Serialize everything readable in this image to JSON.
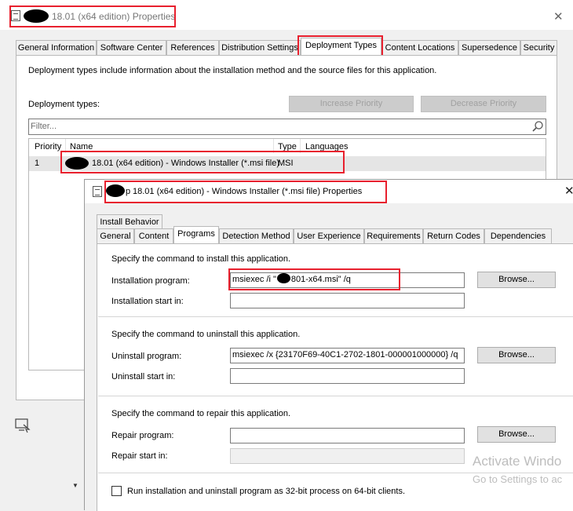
{
  "outer": {
    "title": "18.01 (x64 edition) Properties",
    "tabs": [
      "General Information",
      "Software Center",
      "References",
      "Distribution Settings",
      "Deployment Types",
      "Content Locations",
      "Supersedence",
      "Security"
    ],
    "description": "Deployment types include information about the installation method and the source files for this application.",
    "deployment_types_label": "Deployment types:",
    "increase_priority": "Increase Priority",
    "decrease_priority": "Decrease Priority",
    "filter_placeholder": "Filter...",
    "columns": [
      "Priority",
      "Name",
      "Type",
      "Languages"
    ],
    "row": {
      "priority": "1",
      "name": "18.01 (x64 edition) - Windows Installer (*.msi file)",
      "type": "MSI",
      "languages": ""
    }
  },
  "inner": {
    "title": "18.01 (x64 edition) - Windows Installer (*.msi file) Properties",
    "title_prefix": "p",
    "tab_row1": [
      "Install Behavior"
    ],
    "tabs": [
      "General",
      "Content",
      "Programs",
      "Detection Method",
      "User Experience",
      "Requirements",
      "Return Codes",
      "Dependencies"
    ],
    "install": {
      "heading": "Specify the command to install this application.",
      "program_label": "Installation program:",
      "program_value_a": "msiexec /i \"",
      "program_value_b": "801-x64.msi\" /q",
      "start_label": "Installation start in:",
      "start_value": "",
      "browse": "Browse..."
    },
    "uninstall": {
      "heading": "Specify the command to uninstall this application.",
      "program_label": "Uninstall program:",
      "program_value": "msiexec /x {23170F69-40C1-2702-1801-000001000000} /q",
      "start_label": "Uninstall start in:",
      "start_value": "",
      "browse": "Browse..."
    },
    "repair": {
      "heading": "Specify the command to repair this application.",
      "program_label": "Repair program:",
      "program_value": "",
      "start_label": "Repair start in:",
      "start_value": "",
      "browse": "Browse..."
    },
    "checkbox_label": "Run installation and uninstall program as 32-bit process on 64-bit clients."
  },
  "watermark": {
    "line1": "Activate Windo",
    "line2": "Go to Settings to ac"
  },
  "colors": {
    "highlight": "#e8202e",
    "window_bg": "#f0f0f0"
  }
}
